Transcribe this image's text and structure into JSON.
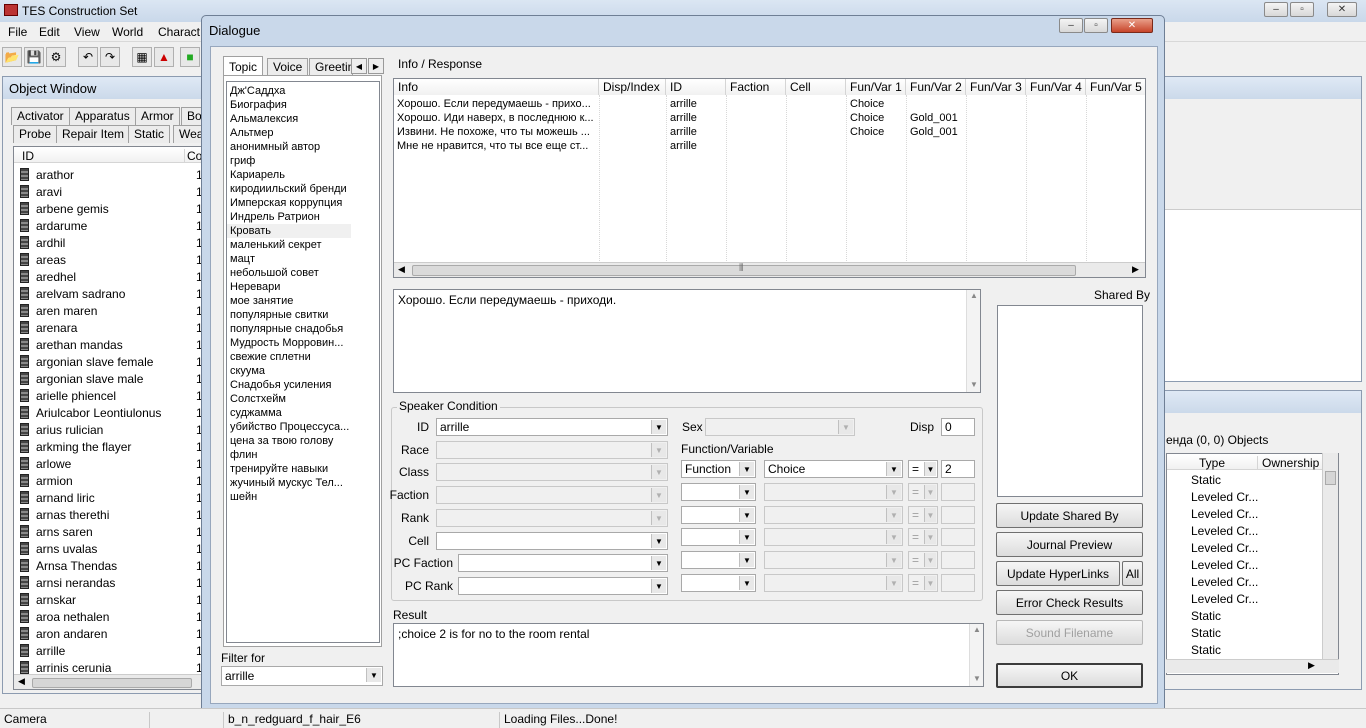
{
  "app": {
    "title": "TES Construction Set",
    "menu": [
      "File",
      "Edit",
      "View",
      "World",
      "Charact"
    ]
  },
  "status_bar": [
    "Camera",
    "b_n_redguard_f_hair_E6",
    "Loading Files...Done!"
  ],
  "object_window": {
    "title": "Object Window",
    "tabs_row1": [
      "Activator",
      "Apparatus",
      "Armor",
      "Bo"
    ],
    "tabs_row2": [
      "Probe",
      "Repair Item",
      "Static",
      "Weap"
    ],
    "columns": [
      "ID",
      "Cou"
    ],
    "items": [
      "arathor",
      "aravi",
      "arbene gemis",
      "ardarume",
      "ardhil",
      "areas",
      "aredhel",
      "arelvam sadrano",
      "aren maren",
      "arenara",
      "arethan mandas",
      "argonian slave female",
      "argonian slave male",
      "arielle phiencel",
      "Ariulcabor Leontiulonus",
      "arius rulician",
      "arkming the flayer",
      "arlowe",
      "armion",
      "arnand liric",
      "arnas therethi",
      "arns saren",
      "arns uvalas",
      "Arnsa Thendas",
      "arnsi nerandas",
      "arnskar",
      "aroa nethalen",
      "aron andaren",
      "arrille",
      "arrinis cerunia"
    ],
    "count_value": "1"
  },
  "render_window": {
    "caption_fragment": "енда (0, 0) Objects",
    "columns": [
      "Type",
      "Ownership"
    ],
    "types": [
      "Static",
      "Leveled Cr...",
      "Leveled Cr...",
      "Leveled Cr...",
      "Leveled Cr...",
      "Leveled Cr...",
      "Leveled Cr...",
      "Leveled Cr...",
      "Static",
      "Static",
      "Static"
    ]
  },
  "dialogue": {
    "title": "Dialogue",
    "tabs": [
      "Topic",
      "Voice",
      "Greeting"
    ],
    "topics": [
      "Дж'Саддха",
      "Биография",
      "Альмалексия",
      "Альтмер",
      "анонимный автор",
      "гриф",
      "Кариарель",
      "киродиильский бренди",
      "Имперская коррупция",
      "Индрель Ратрион",
      "Кровать",
      "маленький секрет",
      "мацт",
      "небольшой совет",
      "Неревари",
      "мое занятие",
      "популярные свитки",
      "популярные снадобья",
      "Мудрость Морровин...",
      "свежие сплетни",
      "скуума",
      "Снадобья усиления",
      "Солстхейм",
      "суджамма",
      "убийство Процессуса...",
      "цена за твою голову",
      "флин",
      "тренируйте навыки",
      "жучиный мускус Тел...",
      "шейн"
    ],
    "filter_label": "Filter for",
    "filter_value": "arrille",
    "info_label": "Info / Response",
    "grid_columns": [
      "Info",
      "Disp/Index",
      "ID",
      "Faction",
      "Cell",
      "Fun/Var 1",
      "Fun/Var 2",
      "Fun/Var 3",
      "Fun/Var 4",
      "Fun/Var 5"
    ],
    "grid_rows": [
      {
        "info": "Хорошо. Если передумаешь - прихо...",
        "id": "arrille",
        "fv1": "Choice",
        "fv2": ""
      },
      {
        "info": "Хорошо. Иди наверх, в последнюю к...",
        "id": "arrille",
        "fv1": "Choice",
        "fv2": "Gold_001"
      },
      {
        "info": "Извини. Не похоже, что ты можешь ...",
        "id": "arrille",
        "fv1": "Choice",
        "fv2": "Gold_001"
      },
      {
        "info": "Мне не нравится, что ты все еще ст...",
        "id": "arrille",
        "fv1": "",
        "fv2": ""
      }
    ],
    "response_text": "Хорошо. Если передумаешь - приходи.",
    "shared_by_label": "Shared By",
    "speaker": {
      "group_label": "Speaker Condition",
      "id_label": "ID",
      "id_value": "arrille",
      "race_label": "Race",
      "class_label": "Class",
      "faction_label": "Faction",
      "rank_label": "Rank",
      "cell_label": "Cell",
      "pc_faction_label": "PC Faction",
      "pc_rank_label": "PC Rank",
      "sex_label": "Sex",
      "disp_label": "Disp",
      "disp_value": "0",
      "funcvar_label": "Function/Variable",
      "func_type": "Function",
      "func_name": "Choice",
      "func_op": "=",
      "func_value": "2"
    },
    "result_label": "Result",
    "result_text": ";choice 2 is for no to the room rental",
    "buttons": {
      "update_shared": "Update Shared By",
      "journal": "Journal Preview",
      "update_hyper": "Update HyperLinks",
      "all": "All",
      "error_check": "Error Check Results",
      "sound": "Sound Filename",
      "ok": "OK"
    }
  }
}
